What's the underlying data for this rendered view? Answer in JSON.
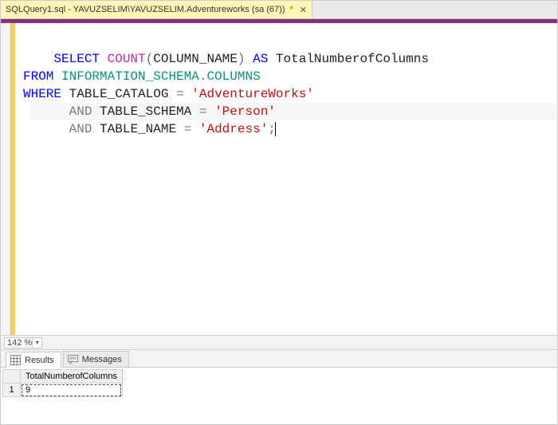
{
  "tab": {
    "title": "SQLQuery1.sql - YAVUZSELIM\\YAVUZSELIM.Adventureworks (sa (67))",
    "unsaved_marker": "*",
    "close_glyph": "✕"
  },
  "sql": {
    "select_kw": "SELECT",
    "count_kw": "COUNT",
    "lparen": "(",
    "column_name": "COLUMN_NAME",
    "rparen": ")",
    "as_kw": "AS",
    "alias": "TotalNumberofColumns",
    "from_kw": "FROM",
    "info_schema": "INFORMATION_SCHEMA",
    "dot": ".",
    "columns_tbl": "COLUMNS",
    "where_kw": "WHERE",
    "table_catalog": "TABLE_CATALOG",
    "eq": "=",
    "adventureworks_lit": "'AdventureWorks'",
    "and_kw": "AND",
    "table_schema": "TABLE_SCHEMA",
    "person_lit": "'Person'",
    "table_name": "TABLE_NAME",
    "address_lit": "'Address'",
    "semicolon": ";"
  },
  "zoom": {
    "value": "142 %"
  },
  "result_tabs": {
    "results_label": "Results",
    "messages_label": "Messages"
  },
  "results": {
    "columns": [
      "TotalNumberofColumns"
    ],
    "rows": [
      {
        "rownum": "1",
        "cells": [
          "9"
        ]
      }
    ]
  }
}
